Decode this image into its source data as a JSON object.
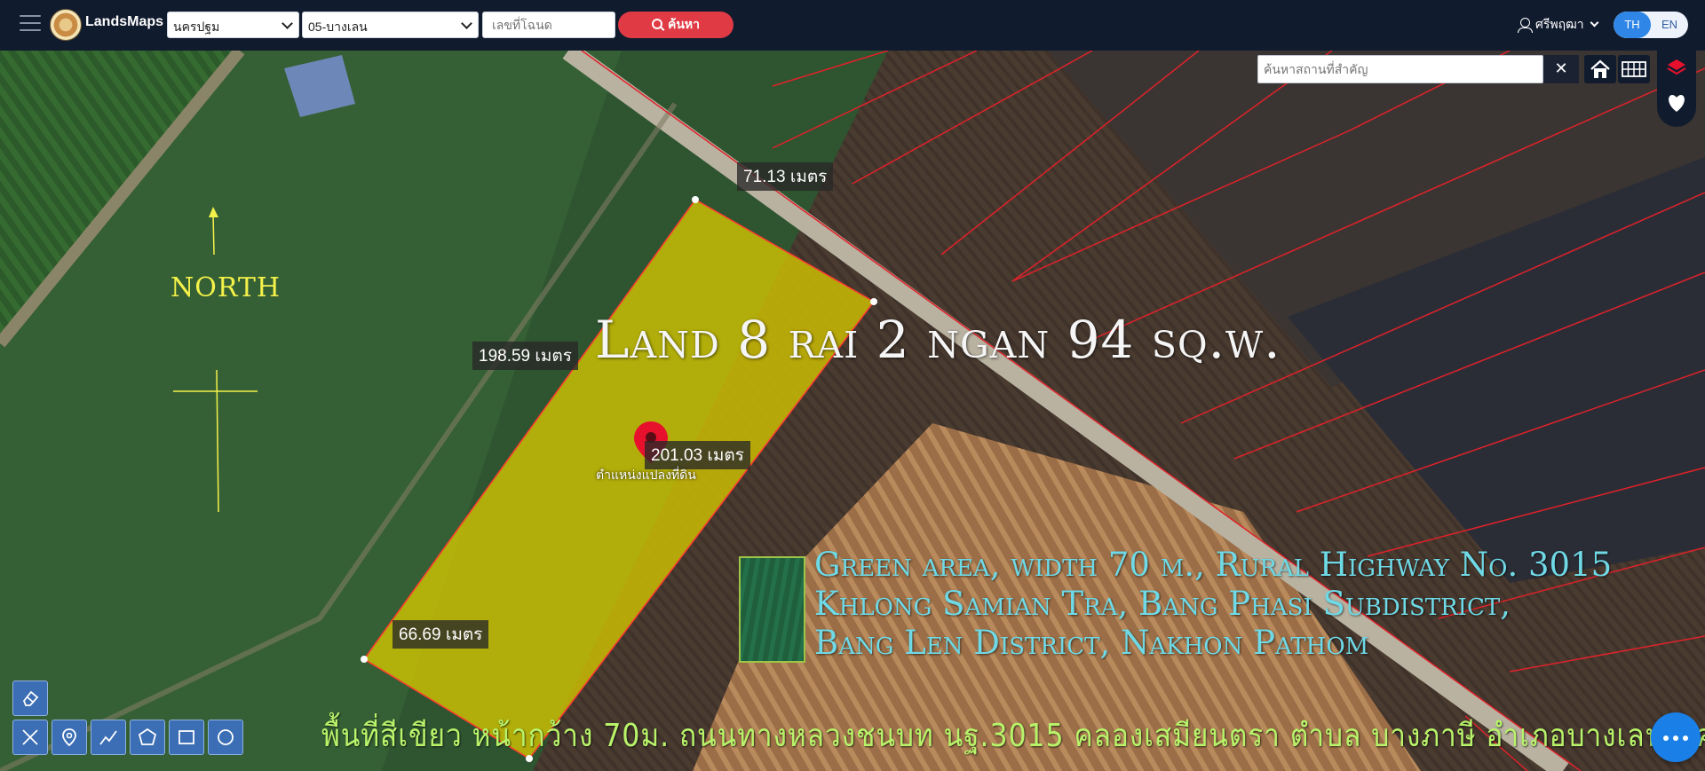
{
  "header": {
    "brand": "LandsMaps",
    "province_select": "นครปฐม",
    "district_select": "05-บางเลน",
    "deed_input_placeholder": "เลขที่โฉนด",
    "search_button": "ค้นหา",
    "user_name": "ศรีพฤฒา",
    "lang_th": "TH",
    "lang_en": "EN"
  },
  "map_controls": {
    "place_search_placeholder": "ค้นหาสถานที่สำคัญ",
    "clear_label": "✕"
  },
  "map": {
    "title": "Land 8 rai 2 ngan 94 sq.w.",
    "north_label": "NORTH",
    "measurements": {
      "top": "71.13 เมตร",
      "left": "198.59 เมตร",
      "right": "201.03 เมตร",
      "bottom": "66.69 เมตร"
    },
    "pin_label": "ตำแหน่งแปลงที่ดิน",
    "info_lines": [
      "Green area, width 70 m., Rural Highway No. 3015",
      "Khlong Samian Tra, Bang Phasi Subdistrict,",
      "Bang Len District, Nakhon Pathom"
    ],
    "thai_caption": "พื้นที่สีเขียว หน้ากว้าง 70ม. ถนนทางหลวงชนบท นฐ.3015 คลองเสมียนตรา ตำบล บางภาษี อำเภอบางเลน นครปฐม",
    "colors": {
      "parcel_fill": "#d6c700",
      "parcel_border": "#ff3b30",
      "boundary_lines": "#e0222a",
      "title_text": "#f5f5f5",
      "info_text": "#6fd9e6",
      "caption_text": "#b8f36a",
      "north_text": "#f4f24a",
      "pin": "#e8112d"
    }
  },
  "tools": {
    "icons": [
      "eraser-icon",
      "measure-icon",
      "location-pin-icon",
      "polyline-icon",
      "polygon-icon",
      "rectangle-icon",
      "circle-icon"
    ]
  }
}
